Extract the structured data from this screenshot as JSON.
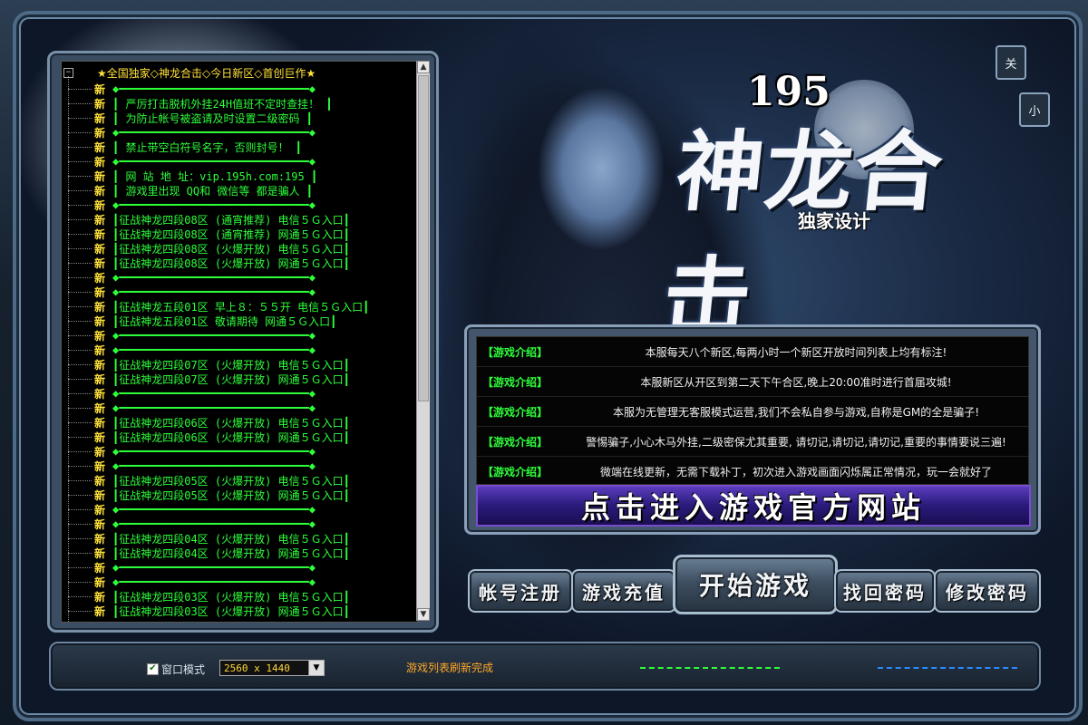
{
  "logo": {
    "number": "195",
    "title": "神龙合击",
    "subtitle": "独家设计"
  },
  "corner_buttons": {
    "top": "关",
    "bottom": "小"
  },
  "server_list": {
    "root_label": "★全国独家◇神龙合击◇今日新区◇首创巨作★",
    "new_tag": "新",
    "rows": [
      "◆━━━━━━━━━━━━━━━━━━━━━━━━━━━━━◆",
      "┃    严厉打击脱机外挂24H值班不定时查挂！    ┃",
      "┃      为防止帐号被盗请及时设置二级密码      ┃",
      "◆━━━━━━━━━━━━━━━━━━━━━━━━━━━━━◆",
      "┃        禁止带空白符号名字，否则封号！      ┃",
      "◆━━━━━━━━━━━━━━━━━━━━━━━━━━━━━◆",
      "┃      网  站  地  址：vip.195h.com:195      ┃",
      "┃       游戏里出现 QQ和 微信等 都是骗人      ┃",
      "◆━━━━━━━━━━━━━━━━━━━━━━━━━━━━━◆",
      "┃征战神龙四段08区  (通宵推荐)  电信５Ｇ入口┃",
      "┃征战神龙四段08区  (通宵推荐)  网通５Ｇ入口┃",
      "┃征战神龙四段08区  (火爆开放)  电信５Ｇ入口┃",
      "┃征战神龙四段08区  (火爆开放)  网通５Ｇ入口┃",
      "◆━━━━━━━━━━━━━━━━━━━━━━━━━━━━━◆",
      "◆━━━━━━━━━━━━━━━━━━━━━━━━━━━━━◆",
      "┃征战神龙五段01区 早上８：５５开 电信５Ｇ入口┃",
      "┃征战神龙五段01区    敬请期待    网通５Ｇ入口┃",
      "◆━━━━━━━━━━━━━━━━━━━━━━━━━━━━━◆",
      "◆━━━━━━━━━━━━━━━━━━━━━━━━━━━━━◆",
      "┃征战神龙四段07区  (火爆开放)  电信５Ｇ入口┃",
      "┃征战神龙四段07区  (火爆开放)  网通５Ｇ入口┃",
      "◆━━━━━━━━━━━━━━━━━━━━━━━━━━━━━◆",
      "◆━━━━━━━━━━━━━━━━━━━━━━━━━━━━━◆",
      "┃征战神龙四段06区  (火爆开放)  电信５Ｇ入口┃",
      "┃征战神龙四段06区  (火爆开放)  网通５Ｇ入口┃",
      "◆━━━━━━━━━━━━━━━━━━━━━━━━━━━━━◆",
      "◆━━━━━━━━━━━━━━━━━━━━━━━━━━━━━◆",
      "┃征战神龙四段05区  (火爆开放)  电信５Ｇ入口┃",
      "┃征战神龙四段05区  (火爆开放)  网通５Ｇ入口┃",
      "◆━━━━━━━━━━━━━━━━━━━━━━━━━━━━━◆",
      "◆━━━━━━━━━━━━━━━━━━━━━━━━━━━━━◆",
      "┃征战神龙四段04区  (火爆开放)  电信５Ｇ入口┃",
      "┃征战神龙四段04区  (火爆开放)  网通５Ｇ入口┃",
      "◆━━━━━━━━━━━━━━━━━━━━━━━━━━━━━◆",
      "◆━━━━━━━━━━━━━━━━━━━━━━━━━━━━━◆",
      "┃征战神龙四段03区  (火爆开放)  电信５Ｇ入口┃",
      "┃征战神龙四段03区  (火爆开放)  网通５Ｇ入口┃"
    ]
  },
  "intro": {
    "tag": "【游戏介绍】",
    "lines": [
      "本服每天八个新区,每两小时一个新区开放时间列表上均有标注!",
      "本服新区从开区到第二天下午合区,晚上20:00准时进行首届攻城!",
      "本服为无管理无客服模式运营,我们不会私自参与游戏,自称是GM的全是骗子!",
      "警惕骗子,小心木马外挂,二级密保尤其重要, 请切记,请切记,请切记,重要的事情要说三遍!",
      "微端在线更新，无需下载补丁，初次进入游戏画面闪烁属正常情况，玩一会就好了"
    ],
    "banner": "点击进入游戏官方网站"
  },
  "buttons": {
    "register": "帐号注册",
    "recharge": "游戏充值",
    "start": "开始游戏",
    "recover": "找回密码",
    "change_pwd": "修改密码"
  },
  "status": {
    "window_mode_label": "窗口模式",
    "window_mode_checked": true,
    "resolution": "2560 x 1440",
    "message": "游戏列表刷新完成"
  },
  "colors": {
    "list_text": "#2dff3a",
    "new_tag": "#ffe23a",
    "status_msg": "#ffa826"
  }
}
